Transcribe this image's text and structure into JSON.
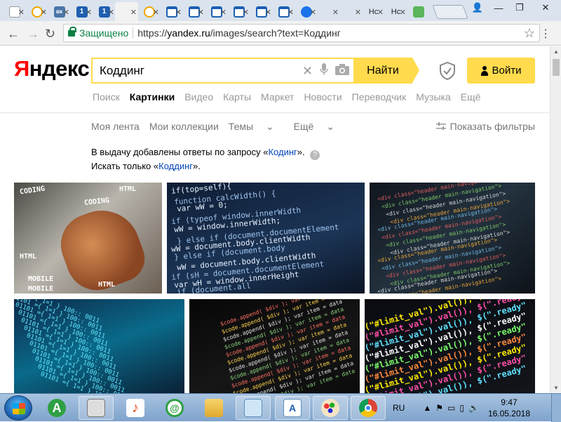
{
  "browser": {
    "tabs": [
      {
        "kind": "doc"
      },
      {
        "kind": "mail"
      },
      {
        "kind": "vk",
        "glyph": "вк"
      },
      {
        "kind": "one",
        "glyph": "1"
      },
      {
        "kind": "one",
        "glyph": "1"
      },
      {
        "kind": "active"
      },
      {
        "kind": "mail"
      },
      {
        "kind": "win"
      },
      {
        "kind": "win"
      },
      {
        "kind": "win"
      },
      {
        "kind": "win"
      },
      {
        "kind": "win"
      },
      {
        "kind": "win"
      },
      {
        "kind": "g"
      },
      {
        "kind": "blank"
      },
      {
        "kind": "blank"
      },
      {
        "kind": "text",
        "label": "Нс"
      },
      {
        "kind": "text",
        "label": "Нс"
      },
      {
        "kind": "green"
      }
    ],
    "secure_label": "Защищено",
    "url_prefix": "https://",
    "url_host": "yandex.ru",
    "url_path": "/images/search?text=Коддинг"
  },
  "yandex": {
    "logo_first": "Я",
    "logo_rest": "ндекс",
    "query": "Коддинг",
    "find_label": "Найти",
    "login_label": "Войти",
    "services": [
      {
        "label": "Поиск",
        "active": false
      },
      {
        "label": "Картинки",
        "active": true
      },
      {
        "label": "Видео",
        "active": false
      },
      {
        "label": "Карты",
        "active": false
      },
      {
        "label": "Маркет",
        "active": false
      },
      {
        "label": "Новости",
        "active": false
      },
      {
        "label": "Переводчик",
        "active": false
      },
      {
        "label": "Музыка",
        "active": false
      },
      {
        "label": "Ещё",
        "active": false
      }
    ],
    "subnav": {
      "feed": "Моя лента",
      "collections": "Мои коллекции",
      "themes": "Темы",
      "more": "Ещё"
    },
    "filters_label": "Показать фильтры",
    "notice": {
      "line1_prefix": "В выдачу добавлены ответы по запросу «",
      "line1_link": "Кодинг",
      "line1_suffix": "».",
      "line2_prefix": "Искать только «",
      "line2_link": "Коддинг",
      "line2_suffix": "»."
    },
    "images": [
      {
        "alt": "coding words on hand and keyboard",
        "words": [
          "CODING",
          "HTML",
          "CODING",
          "HTML",
          "MOBILE",
          "HTML",
          "MOBILE"
        ]
      },
      {
        "alt": "javascript code on blue screen",
        "lines": [
          "if(top=self){",
          "function calcWidth() {",
          "var wW = 0;",
          "if (typeof window.innerWidth",
          "wW = window.innerWidth;",
          "} else if (document.documentElement",
          "wW = document.body.clientWidth",
          "} else if (document.body",
          "wW = document.body.clientWidth",
          "if (sH = document.documentElement",
          "var wH = window.innerHeight",
          "if (document.all"
        ]
      },
      {
        "alt": "html source code in editor"
      },
      {
        "alt": "cyan code perspective"
      },
      {
        "alt": "source code on dark screen"
      },
      {
        "alt": "colorful javascript code"
      }
    ]
  },
  "taskbar": {
    "language": "RU",
    "time": "9:47",
    "date": "16.05.2018"
  }
}
